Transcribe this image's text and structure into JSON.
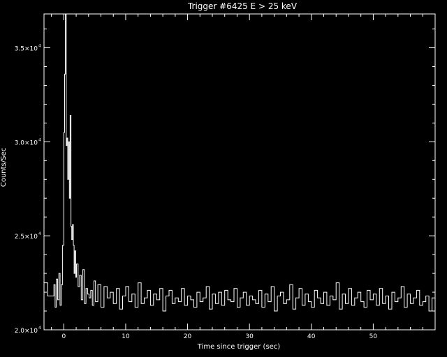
{
  "chart_data": {
    "type": "line",
    "title": "Trigger #6425 E > 25 keV",
    "xlabel": "Time since trigger (sec)",
    "ylabel": "Counts/Sec",
    "xlim": [
      -3.2,
      60
    ],
    "ylim": [
      20000,
      36800
    ],
    "grid": false,
    "step": true,
    "x_ticks": [
      0,
      10,
      20,
      30,
      40,
      50
    ],
    "x_tick_labels": [
      "0",
      "10",
      "20",
      "30",
      "40",
      "50"
    ],
    "y_ticks": [
      20000,
      25000,
      30000,
      35000
    ],
    "y_tick_labels": [
      {
        "mantissa": "2.0×10",
        "exponent": "4"
      },
      {
        "mantissa": "2.5×10",
        "exponent": "4"
      },
      {
        "mantissa": "3.0×10",
        "exponent": "4"
      },
      {
        "mantissa": "3.5×10",
        "exponent": "4"
      }
    ],
    "series": [
      {
        "values_note": "",
        "x": [
          -3.2,
          -2.6,
          -1.6,
          -1.4,
          -1.2,
          -1.0,
          -0.8,
          -0.6,
          -0.4,
          -0.2,
          0.0,
          0.128,
          0.256,
          0.384,
          0.512,
          0.64,
          0.768,
          0.896,
          1.024,
          1.152,
          1.28,
          1.408,
          1.536,
          1.664,
          1.792,
          1.92,
          2.048,
          2.304,
          2.56,
          2.816,
          3.072,
          3.328,
          3.584,
          3.84,
          4.096,
          4.352,
          4.608,
          4.864,
          5.12,
          5.5,
          6.0,
          6.5,
          7.0,
          7.5,
          8.0,
          8.5,
          9.0,
          9.5,
          10.0,
          10.5,
          11.0,
          11.5,
          12.0,
          12.5,
          13.0,
          13.5,
          14.0,
          14.5,
          15.0,
          15.5,
          16.0,
          16.5,
          17.0,
          17.5,
          18.0,
          18.5,
          19.0,
          19.5,
          20.0,
          20.5,
          21.0,
          21.5,
          22.0,
          22.5,
          23.0,
          23.5,
          24.0,
          24.5,
          25.0,
          25.5,
          26.0,
          26.5,
          27.0,
          27.5,
          28.0,
          28.5,
          29.0,
          29.5,
          30.0,
          30.5,
          31.0,
          31.5,
          32.0,
          32.5,
          33.0,
          33.5,
          34.0,
          34.5,
          35.0,
          35.5,
          36.0,
          36.5,
          37.0,
          37.5,
          38.0,
          38.5,
          39.0,
          39.5,
          40.0,
          40.5,
          41.0,
          41.5,
          42.0,
          42.5,
          43.0,
          43.5,
          44.0,
          44.5,
          45.0,
          45.5,
          46.0,
          46.5,
          47.0,
          47.5,
          48.0,
          48.5,
          49.0,
          49.5,
          50.0,
          50.5,
          51.0,
          51.5,
          52.0,
          52.5,
          53.0,
          53.5,
          54.0,
          54.5,
          55.0,
          55.5,
          56.0,
          56.5,
          57.0,
          57.5,
          58.0,
          58.5,
          59.0,
          59.5,
          60.0
        ],
        "values": [
          22500,
          21800,
          22400,
          21200,
          22700,
          21600,
          23000,
          21300,
          22400,
          24500,
          30500,
          33600,
          36800,
          29800,
          30200,
          28000,
          30000,
          27000,
          31400,
          25500,
          24800,
          25600,
          24500,
          23000,
          24200,
          22800,
          23500,
          22300,
          22900,
          21600,
          23200,
          21400,
          22200,
          21900,
          21700,
          22100,
          21300,
          22600,
          21500,
          22400,
          21200,
          22300,
          21700,
          22000,
          21400,
          22200,
          21100,
          21800,
          22300,
          21500,
          21900,
          21200,
          22500,
          21400,
          21700,
          22100,
          21300,
          21900,
          21600,
          22200,
          21000,
          21800,
          22100,
          21400,
          21700,
          21500,
          22200,
          21300,
          21800,
          21600,
          21200,
          22000,
          21500,
          21700,
          22300,
          21100,
          21900,
          21400,
          22000,
          21300,
          22100,
          21600,
          21500,
          22200,
          21200,
          21700,
          22000,
          21300,
          21800,
          21600,
          21400,
          22100,
          21200,
          21900,
          21500,
          22300,
          21000,
          21800,
          22000,
          21400,
          21600,
          22400,
          21100,
          21700,
          22200,
          21300,
          21900,
          21500,
          21200,
          22100,
          21700,
          21400,
          22000,
          21300,
          21800,
          21600,
          22500,
          21100,
          21900,
          21400,
          22200,
          21300,
          21700,
          22000,
          21500,
          21200,
          22100,
          21600,
          21900,
          21300,
          22200,
          21400,
          21800,
          21100,
          22000,
          21500,
          21700,
          22300,
          21200,
          21900,
          21400,
          21700,
          22100,
          21300,
          21500,
          21800,
          21000,
          21700,
          21200
        ]
      }
    ]
  }
}
